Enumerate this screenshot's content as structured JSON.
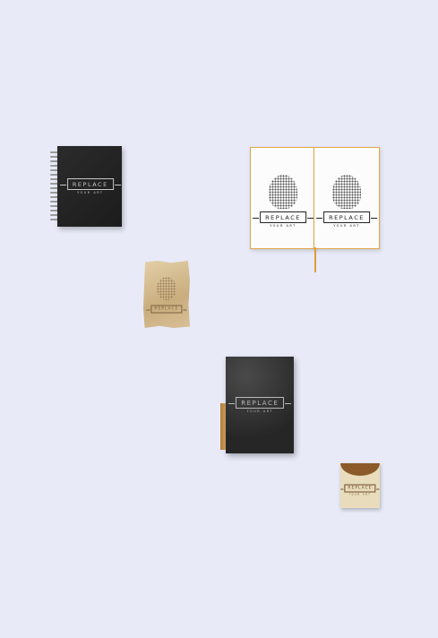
{
  "logo": {
    "title": "REPLACE",
    "subtitle": "YOUR ART"
  }
}
